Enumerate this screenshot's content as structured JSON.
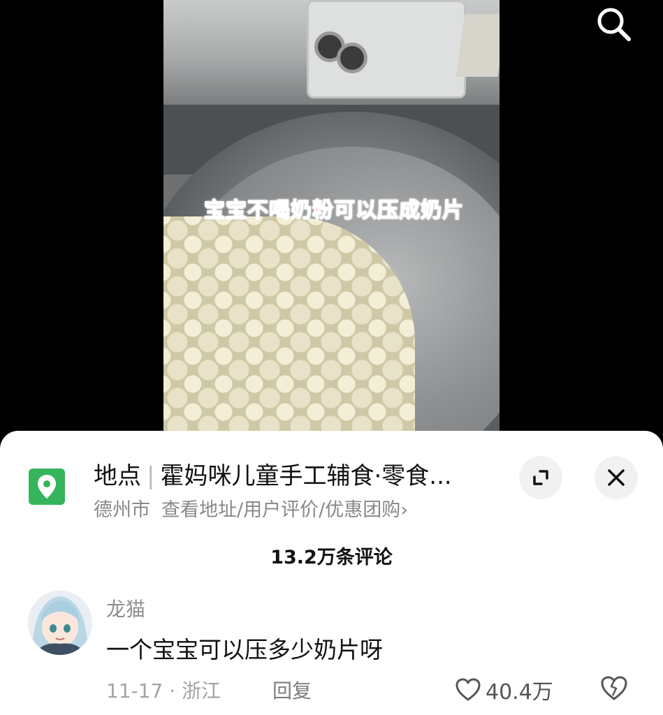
{
  "video": {
    "caption": "宝宝不喝奶粉可以压成奶片",
    "search_icon": "search-icon"
  },
  "location": {
    "icon": "map-pin-icon",
    "label": "地点",
    "name": "霍妈咪儿童手工辅食·零食...",
    "city": "德州市",
    "links": "查看地址/用户评价/优惠团购",
    "chevron": "›"
  },
  "actions": {
    "expand_icon": "expand-icon",
    "close_icon": "close-icon"
  },
  "comments": {
    "count_label": "13.2万条评论",
    "items": [
      {
        "username": "龙猫",
        "text": "一个宝宝可以压多少奶片呀",
        "date": "11-17",
        "dot": "·",
        "region": "浙江",
        "reply_label": "回复",
        "likes": "40.4万"
      }
    ]
  },
  "colors": {
    "location_icon_bg": "#35b45b",
    "caption_text": "#ff4d6d",
    "sheet_bg": "#ffffff"
  }
}
